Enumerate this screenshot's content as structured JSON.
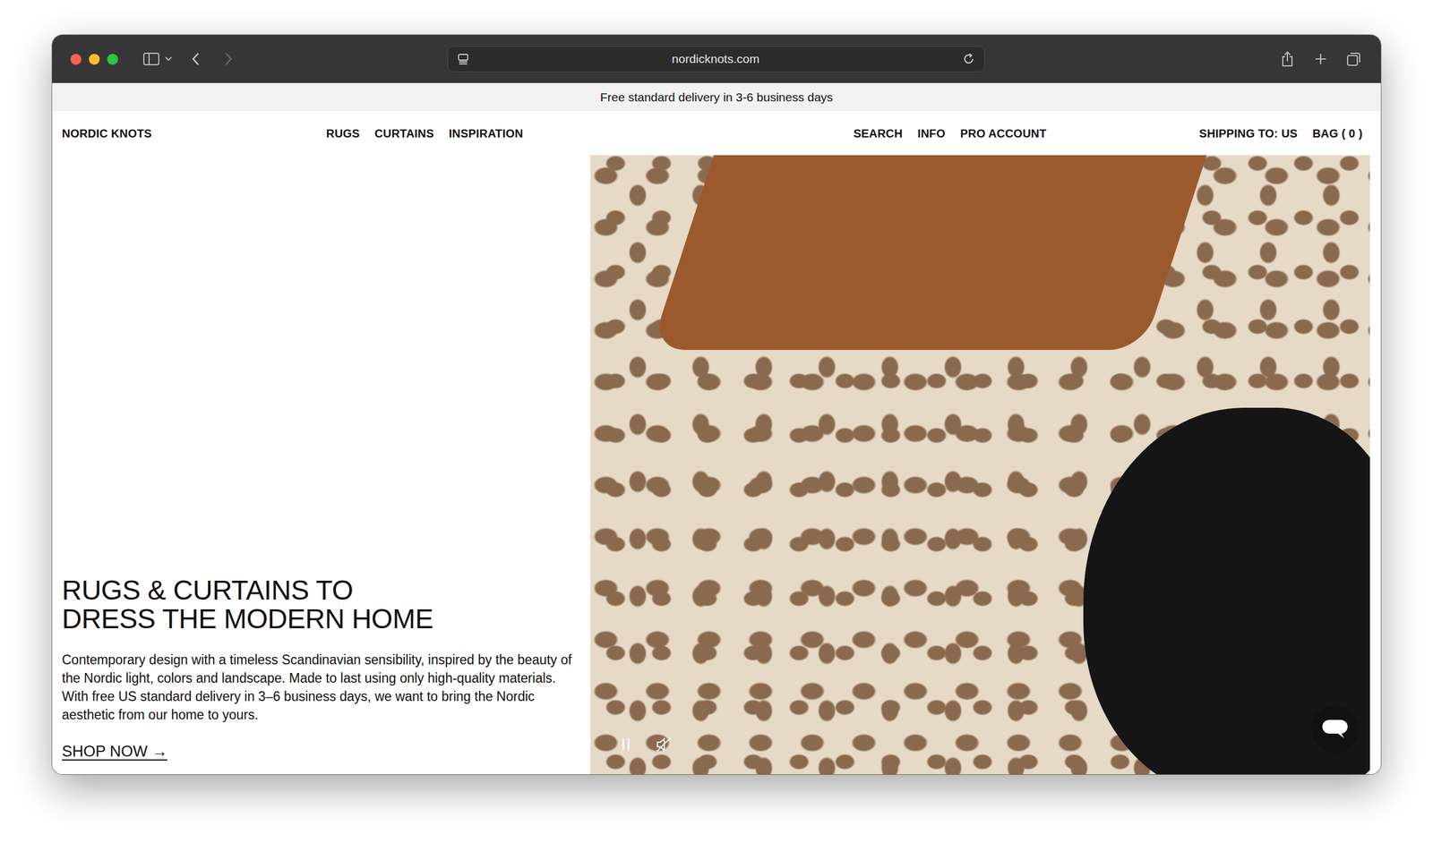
{
  "browser": {
    "address": "nordicknots.com"
  },
  "announcement": "Free standard delivery in 3-6 business days",
  "nav": {
    "brand": "NORDIC KNOTS",
    "main_links": [
      "RUGS",
      "CURTAINS",
      "INSPIRATION"
    ],
    "utility_links": [
      "SEARCH",
      "INFO",
      "PRO ACCOUNT"
    ],
    "shipping": "SHIPPING TO: US",
    "bag": "BAG ( 0 )"
  },
  "hero": {
    "title_lines": [
      "RUGS & CURTAINS TO",
      "DRESS THE MODERN HOME"
    ],
    "body": "Contemporary design with a timeless Scandinavian sensibility, inspired by the beauty of the Nordic light, colors and landscape. Made to last using only high-quality materials. With free US standard delivery in 3–6 business days, we want to bring the Nordic aesthetic from our home to yours.",
    "cta": "SHOP NOW →",
    "video": {
      "playing": true,
      "muted": true
    }
  }
}
